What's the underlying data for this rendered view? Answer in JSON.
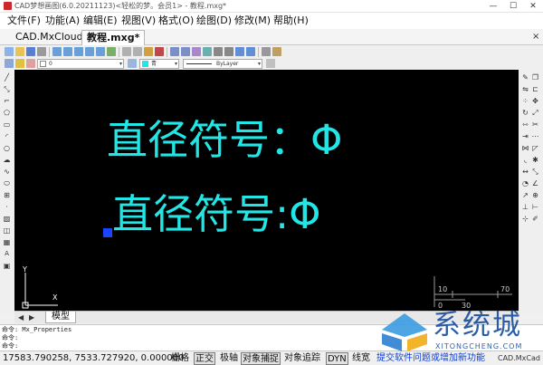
{
  "window": {
    "title": "CAD梦想画图(6.0.20211123)<轻松的梦。会员1> - 教程.mxg*",
    "minimize_glyph": "—",
    "maximize_glyph": "☐",
    "close_glyph": "✕"
  },
  "menu": {
    "items": [
      "文件(F)",
      "功能(A)",
      "编辑(E)",
      "视图(V)",
      "格式(O)",
      "绘图(D)",
      "修改(M)",
      "帮助(H)"
    ]
  },
  "tabs": {
    "items": [
      "CAD.MxCloud",
      "教程.mxg*"
    ],
    "close_glyph": "×",
    "active_index": 1
  },
  "layer_toolbar": {
    "layer_value": "0",
    "color_value": "青",
    "linetype_value": "ByLayer",
    "dropdown_glyph": "▾"
  },
  "drawing": {
    "text_line_1": "直径符号：Φ",
    "text_line_2": "直径符号:Φ",
    "text_color": "#22e6e6",
    "background": "#000000",
    "grip_color": "#1a44ff",
    "ucs_y_label": "Y",
    "ucs_x_label": "X",
    "scale_labels": [
      "10",
      "70",
      "0",
      "30"
    ]
  },
  "model_tabs": {
    "nav_glyphs": [
      "◀",
      "▶"
    ],
    "active": "模型"
  },
  "command": {
    "lines": [
      "命令: Mx_Properties",
      "命令:",
      "命令:"
    ]
  },
  "status": {
    "coords": "17583.790258, 7533.727920, 0.000000",
    "toggles": [
      {
        "label": "栅格",
        "on": false
      },
      {
        "label": "正交",
        "on": true
      },
      {
        "label": "极轴",
        "on": false
      },
      {
        "label": "对象捕捉",
        "on": true
      },
      {
        "label": "对象追踪",
        "on": false
      },
      {
        "label": "DYN",
        "on": true
      },
      {
        "label": "线宽",
        "on": false
      }
    ],
    "feedback": "提交软件问题或增加新功能",
    "brand": "CAD.MxCad"
  },
  "watermark": {
    "text": "系统城",
    "subtitle": "XITONGCHENG.COM"
  }
}
